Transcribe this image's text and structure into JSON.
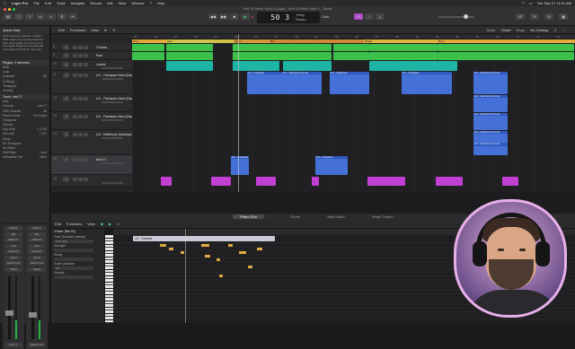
{
  "menubar": {
    "app": "Logic Pro",
    "items": [
      "File",
      "Edit",
      "Track",
      "Navigate",
      "Record",
      "Mix",
      "View",
      "Window",
      "?",
      "Help"
    ],
    "clock": "Tue Sep 27 11:01 AM"
  },
  "window": {
    "title": "How To Remix Synth 2 (Logic) - How To Remix Synth 2 - Tracks"
  },
  "lcd": {
    "position": "50 3",
    "tempo_label": "Keep",
    "tempo_sub": "Tempo",
    "key": "C#m"
  },
  "quick_help": {
    "title": "Quick Help",
    "text": "Note Inspector: Activate a track's MIDI output so it can be looked at from other tracks. Use UI as such and region inspector to modify the note data. Press M for more info."
  },
  "inspector": {
    "region_section": "Region: 2 selected",
    "region_rows": [
      {
        "label": "Mute",
        "value": ""
      },
      {
        "label": "Loop",
        "value": ""
      },
      {
        "label": "Quantize",
        "value": "Off"
      },
      {
        "label": "Q-Swing",
        "value": ""
      },
      {
        "label": "Transpose",
        "value": ""
      },
      {
        "label": "Velocity",
        "value": ""
      }
    ],
    "track_section": "Track: Inst 17",
    "track_rows": [
      {
        "label": "Icon",
        "value": ""
      },
      {
        "label": "Channel",
        "value": "Inst 17"
      },
      {
        "label": "MIDI Channel",
        "value": "All"
      },
      {
        "label": "Freeze Mode",
        "value": "Pre Fader"
      },
      {
        "label": "Transpose",
        "value": ""
      },
      {
        "label": "Velocity",
        "value": ""
      },
      {
        "label": "Key Limit",
        "value": "C-2 G8"
      },
      {
        "label": "Vel Limit",
        "value": "1 127"
      },
      {
        "label": "Delay",
        "value": ""
      },
      {
        "label": "No Transpose",
        "value": ""
      },
      {
        "label": "No Reset",
        "value": ""
      },
      {
        "label": "Staff Style",
        "value": "Auto"
      },
      {
        "label": "Articulation Set",
        "value": "None"
      }
    ],
    "strip_slots": [
      "Setting",
      "EQ",
      "MIDI FX",
      "Inst",
      "Audio FX",
      "Send",
      "Stereo Out",
      "Read"
    ],
    "strip_names": [
      "Inst 17",
      "Stereo Out"
    ]
  },
  "tracks_bar": {
    "items": [
      "Edit",
      "Functions",
      "View"
    ],
    "snap_label": "Snap:",
    "snap_value": "Smart",
    "drag_label": "Drag:",
    "drag_value": "No Overlap"
  },
  "tracks": [
    {
      "num": "8",
      "name": "Chords"
    },
    {
      "num": "9",
      "name": "Pad"
    },
    {
      "num": "10",
      "name": "Leads"
    },
    {
      "num": "11",
      "name": "LD - Fantasia Hero (Dark Synthwave)"
    },
    {
      "num": "12",
      "name": "LD - Fantasia Hero (Dark Synthwave)"
    },
    {
      "num": "13",
      "name": "LD - Fantasia Hero (Dark Synthwave)"
    },
    {
      "num": "14",
      "name": "LD - Nebhunk (Darksynth)"
    },
    {
      "num": "15",
      "name": "Inst 17"
    },
    {
      "num": "16",
      "name": ""
    }
  ],
  "ruler": {
    "bars": [
      "33",
      "35",
      "37",
      "39",
      "41",
      "43",
      "45",
      "47",
      "49",
      "51",
      "53",
      "55",
      "57",
      "59",
      "61",
      "63",
      "65",
      "67",
      "69",
      "71",
      "73",
      "75"
    ]
  },
  "markers": [
    {
      "label": "Drop",
      "color": "#e5a93c"
    },
    {
      "label": "Intro",
      "color": "#d0c24a"
    },
    {
      "label": "Verse",
      "color": "#d79a3a"
    },
    {
      "label": "Pre",
      "color": "#d18a33"
    },
    {
      "label": "Bridge",
      "color": "#e1b440"
    },
    {
      "label": "Drop",
      "color": "#e5a93c"
    }
  ],
  "regions_lead": [
    {
      "label": "LD - Fantasia"
    },
    {
      "label": "LD - Nebhunk Chunk"
    },
    {
      "label": "LD - Nebhunk"
    },
    {
      "label": "LD - Fantasia"
    },
    {
      "label": "LD - Nebhunk Chunk"
    },
    {
      "label": "LD - Nebhunk Chunk"
    },
    {
      "label": "LD - Nebhunk Chunk"
    },
    {
      "label": "LD - Nebhunk Chunk"
    },
    {
      "label": "LD - Nebhunk Chunk"
    },
    {
      "label": "LD - Fantasia"
    },
    {
      "label": "LD - Fantasia"
    }
  ],
  "editor": {
    "tabs": [
      "Piano Roll",
      "Score",
      "Step Editor",
      "Smart Tempo"
    ],
    "active_tab": "Piano Roll",
    "toolbar": [
      "Edit",
      "Functions",
      "View"
    ],
    "left_rows": [
      "Time Quantize (classic)",
      "1/16 Note",
      "Strength",
      "Swing",
      "",
      "Scale Quantize",
      "Off",
      "Velocity"
    ],
    "region_label": "LD - Fantasia",
    "track_label": "4 Note: (Bar 51)"
  },
  "colors": {
    "green_region": "#3cc24a",
    "teal_region": "#1eb5a7",
    "blue_region": "#4470d8",
    "magenta_region": "#c23fd3",
    "note": "#e0aa42"
  }
}
